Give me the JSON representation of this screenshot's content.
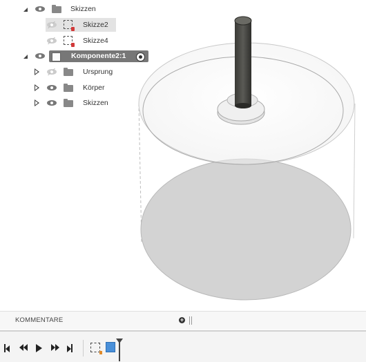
{
  "browser": {
    "items": [
      {
        "label": "Skizzen"
      },
      {
        "label": "Skizze2"
      },
      {
        "label": "Skizze4"
      },
      {
        "label": "Komponente2:1"
      },
      {
        "label": "Ursprung"
      },
      {
        "label": "Körper"
      },
      {
        "label": "Skizzen"
      }
    ]
  },
  "comments": {
    "title": "KOMMENTARE",
    "add_glyph": "+"
  },
  "timeline": {
    "icons": [
      "go-to-start-icon",
      "step-back-icon",
      "play-icon",
      "step-forward-icon",
      "go-to-end-icon",
      "sketch-feature-icon",
      "body-feature-icon",
      "timeline-marker-icon"
    ]
  },
  "colors": {
    "accent_blue": "#4a90d9",
    "sketch_warning": "#d23a3a",
    "selected_row": "#e3e3e3",
    "component_header": "#777777"
  }
}
